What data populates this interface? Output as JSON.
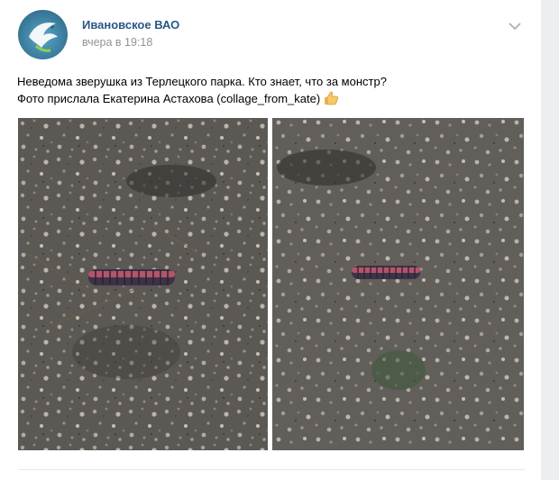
{
  "post": {
    "author": "Ивановское ВАО",
    "time": "вчера в 19:18",
    "text_line1": "Неведома зверушка из Терлецкого парка. Кто знает, что за монстр?",
    "text_line2": "Фото прислала Екатерина Астахова (collage_from_kate)",
    "emoji": "thumbs-up-icon",
    "photos": [
      "caterpillar-photo-1",
      "caterpillar-photo-2"
    ]
  },
  "colors": {
    "author_link": "#2a5885",
    "meta_text": "#939393",
    "side_background": "#edeef0"
  }
}
